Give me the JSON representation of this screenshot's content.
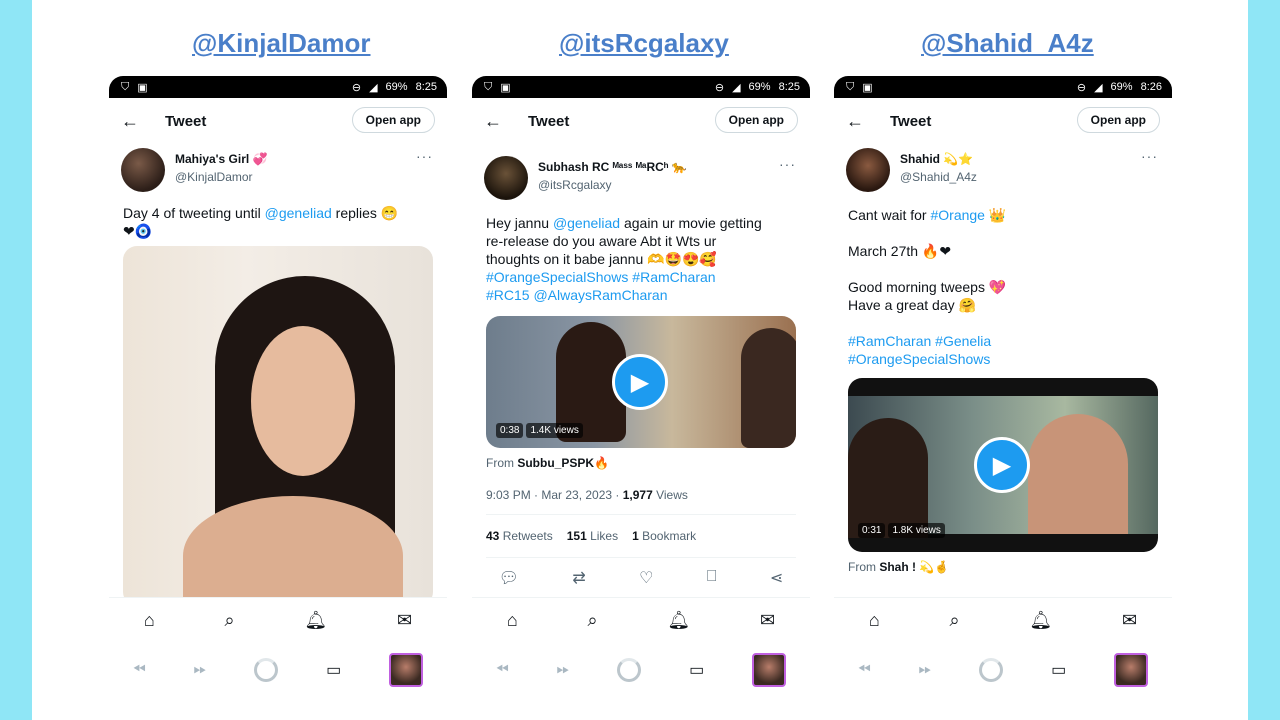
{
  "status": {
    "battery": "69%",
    "time1": "8:25",
    "time2": "8:25",
    "time3": "8:26"
  },
  "panels": [
    {
      "handle": "@KinjalDamor",
      "appbar": {
        "title": "Tweet",
        "open_app": "Open app"
      },
      "author": {
        "display_name": "Mahiya's Girl 💞",
        "username": "@KinjalDamor"
      },
      "text": {
        "pre": "Day 4 of tweeting until ",
        "mention": "@geneliad",
        "post": " replies 😁",
        "line2": "❤🧿"
      }
    },
    {
      "handle": "@itsRcgalaxy",
      "appbar": {
        "title": "Tweet",
        "open_app": "Open app"
      },
      "author": {
        "display_name": "Subhash RC ᴹᵃˢˢ ᴹᵃRCʰ 🐆",
        "username": "@itsRcgalaxy"
      },
      "text": {
        "l1a": "Hey jannu ",
        "l1m": "@geneliad",
        "l1b": "  again ur movie getting",
        "l2": "re-release do you aware Abt it Wts ur",
        "l3": "thoughts on it babe jannu  🫶🤩😍🥰",
        "l4": "#OrangeSpecialShows #RamCharan",
        "l5": "#RC15 @AlwaysRamCharan"
      },
      "video": {
        "duration": "0:38",
        "views": "1.4K views"
      },
      "from": {
        "label": "From ",
        "name": "Subbu_PSPK🔥"
      },
      "meta": {
        "time": "9:03 PM · Mar 23, 2023 · ",
        "views_count": "1,977",
        "views_label": " Views"
      },
      "stats": {
        "retweets": "43",
        "retweets_label": " Retweets",
        "likes": "151",
        "likes_label": " Likes",
        "bookmarks": "1",
        "bookmarks_label": " Bookmark"
      }
    },
    {
      "handle": "@Shahid_A4z",
      "appbar": {
        "title": "Tweet",
        "open_app": "Open app"
      },
      "author": {
        "display_name": "Shahid 💫⭐",
        "username": "@Shahid_A4z"
      },
      "text": {
        "l1": "Cant wait for ",
        "l1tag": "#Orange",
        "l1e": " 👑",
        "l2": "March 27th 🔥❤",
        "l3": "Good morning tweeps 💖",
        "l4": "Have a great day 🤗",
        "l5": "#RamCharan  #Genelia",
        "l6": "#OrangeSpecialShows"
      },
      "video": {
        "duration": "0:31",
        "views": "1.8K views"
      },
      "from": {
        "label": "From ",
        "name": "Shah ! 💫🤞"
      }
    }
  ],
  "nav_icons": [
    "home-icon",
    "search-icon",
    "bell-icon",
    "mail-icon"
  ],
  "colors": {
    "accent": "#1d9bf0",
    "handle": "#4a7fc9",
    "background": "#8fe6f6"
  }
}
